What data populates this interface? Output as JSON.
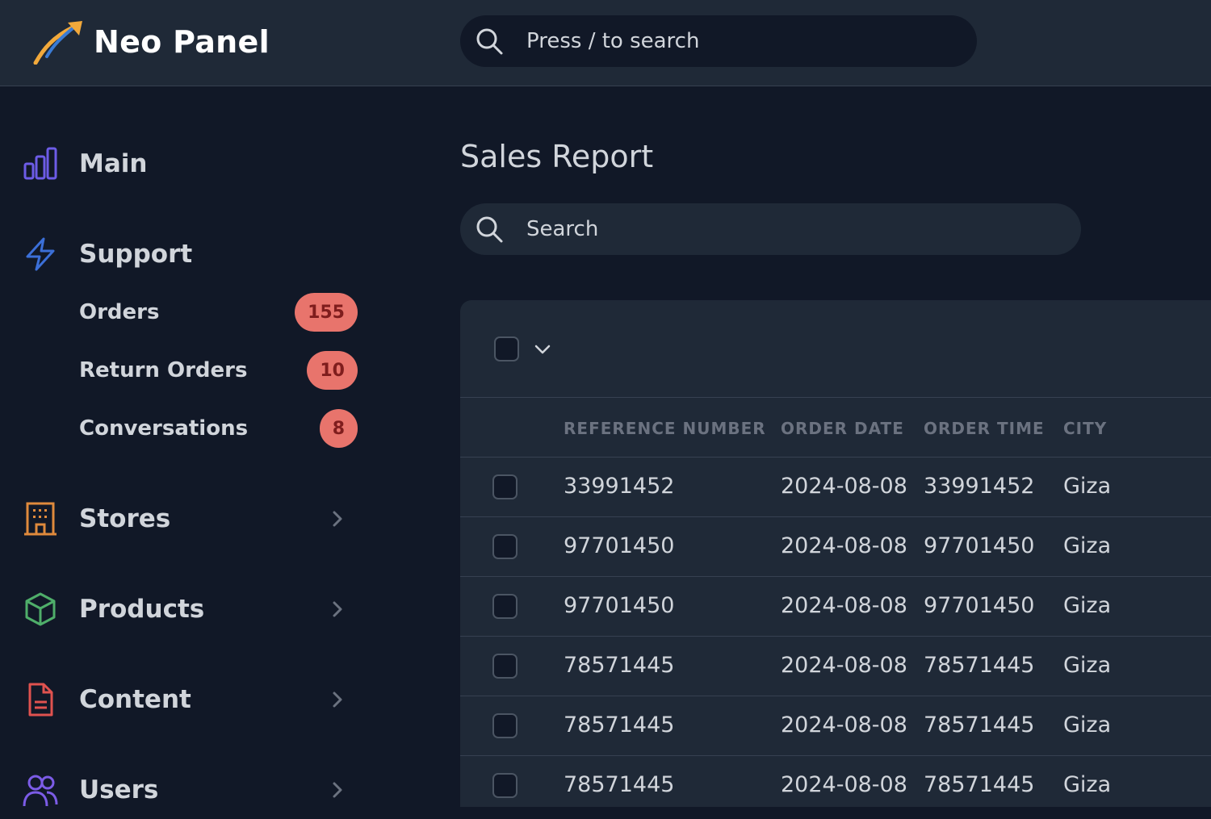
{
  "app": {
    "name": "Neo Panel",
    "top_search_placeholder": "Press / to search"
  },
  "colors": {
    "background": "#111827",
    "panel": "#1f2937",
    "badge": "#e8746c",
    "icon_main": "#6d5ce7",
    "icon_support": "#3b6fd8",
    "icon_stores": "#e08a3c",
    "icon_products": "#4fae6a",
    "icon_content": "#e0524f",
    "icon_users": "#7c5ce7"
  },
  "sidebar": {
    "items": [
      {
        "label": "Main",
        "icon": "bar-chart-icon"
      },
      {
        "label": "Support",
        "icon": "lightning-icon"
      },
      {
        "label": "Stores",
        "icon": "building-icon",
        "has_chevron": true
      },
      {
        "label": "Products",
        "icon": "cube-icon",
        "has_chevron": true
      },
      {
        "label": "Content",
        "icon": "document-icon",
        "has_chevron": true
      },
      {
        "label": "Users",
        "icon": "users-icon",
        "has_chevron": true
      }
    ],
    "support_children": [
      {
        "label": "Orders",
        "badge": "155"
      },
      {
        "label": "Return Orders",
        "badge": "10"
      },
      {
        "label": "Conversations",
        "badge": "8"
      }
    ]
  },
  "main": {
    "title": "Sales Report",
    "search_placeholder": "Search",
    "table": {
      "columns": [
        "REFERENCE NUMBER",
        "ORDER DATE",
        "ORDER TIME",
        "CITY"
      ],
      "rows": [
        [
          "33991452",
          "2024-08-08",
          "33991452",
          "Giza"
        ],
        [
          "97701450",
          "2024-08-08",
          "97701450",
          "Giza"
        ],
        [
          "97701450",
          "2024-08-08",
          "97701450",
          "Giza"
        ],
        [
          "78571445",
          "2024-08-08",
          "78571445",
          "Giza"
        ],
        [
          "78571445",
          "2024-08-08",
          "78571445",
          "Giza"
        ],
        [
          "78571445",
          "2024-08-08",
          "78571445",
          "Giza"
        ]
      ]
    }
  }
}
